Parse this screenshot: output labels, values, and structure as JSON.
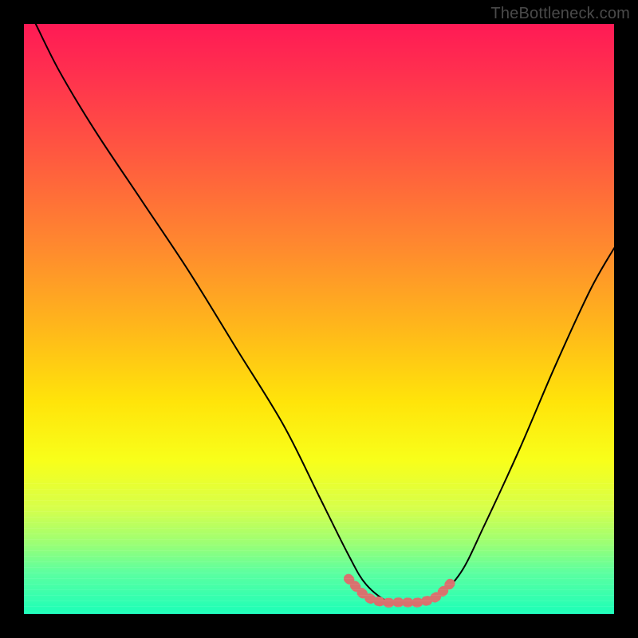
{
  "credit": "TheBottleneck.com",
  "chart_data": {
    "type": "line",
    "title": "",
    "xlabel": "",
    "ylabel": "",
    "xlim": [
      0,
      100
    ],
    "ylim": [
      0,
      100
    ],
    "series": [
      {
        "name": "bottleneck-curve",
        "x": [
          2,
          6,
          12,
          20,
          28,
          36,
          44,
          50,
          55,
          58,
          62,
          66,
          70,
          74,
          78,
          84,
          90,
          96,
          100
        ],
        "y": [
          100,
          92,
          82,
          70,
          58,
          45,
          32,
          20,
          10,
          5,
          2,
          2,
          3,
          7,
          15,
          28,
          42,
          55,
          62
        ]
      },
      {
        "name": "highlight-band",
        "x": [
          55,
          58,
          61,
          64,
          67,
          70,
          73
        ],
        "y": [
          6,
          3,
          2,
          2,
          2,
          3,
          6
        ]
      }
    ],
    "annotations": []
  },
  "colors": {
    "curve": "#000000",
    "highlight": "#d8716e",
    "background_top": "#ff1a55",
    "background_bottom": "#1cffb8"
  }
}
